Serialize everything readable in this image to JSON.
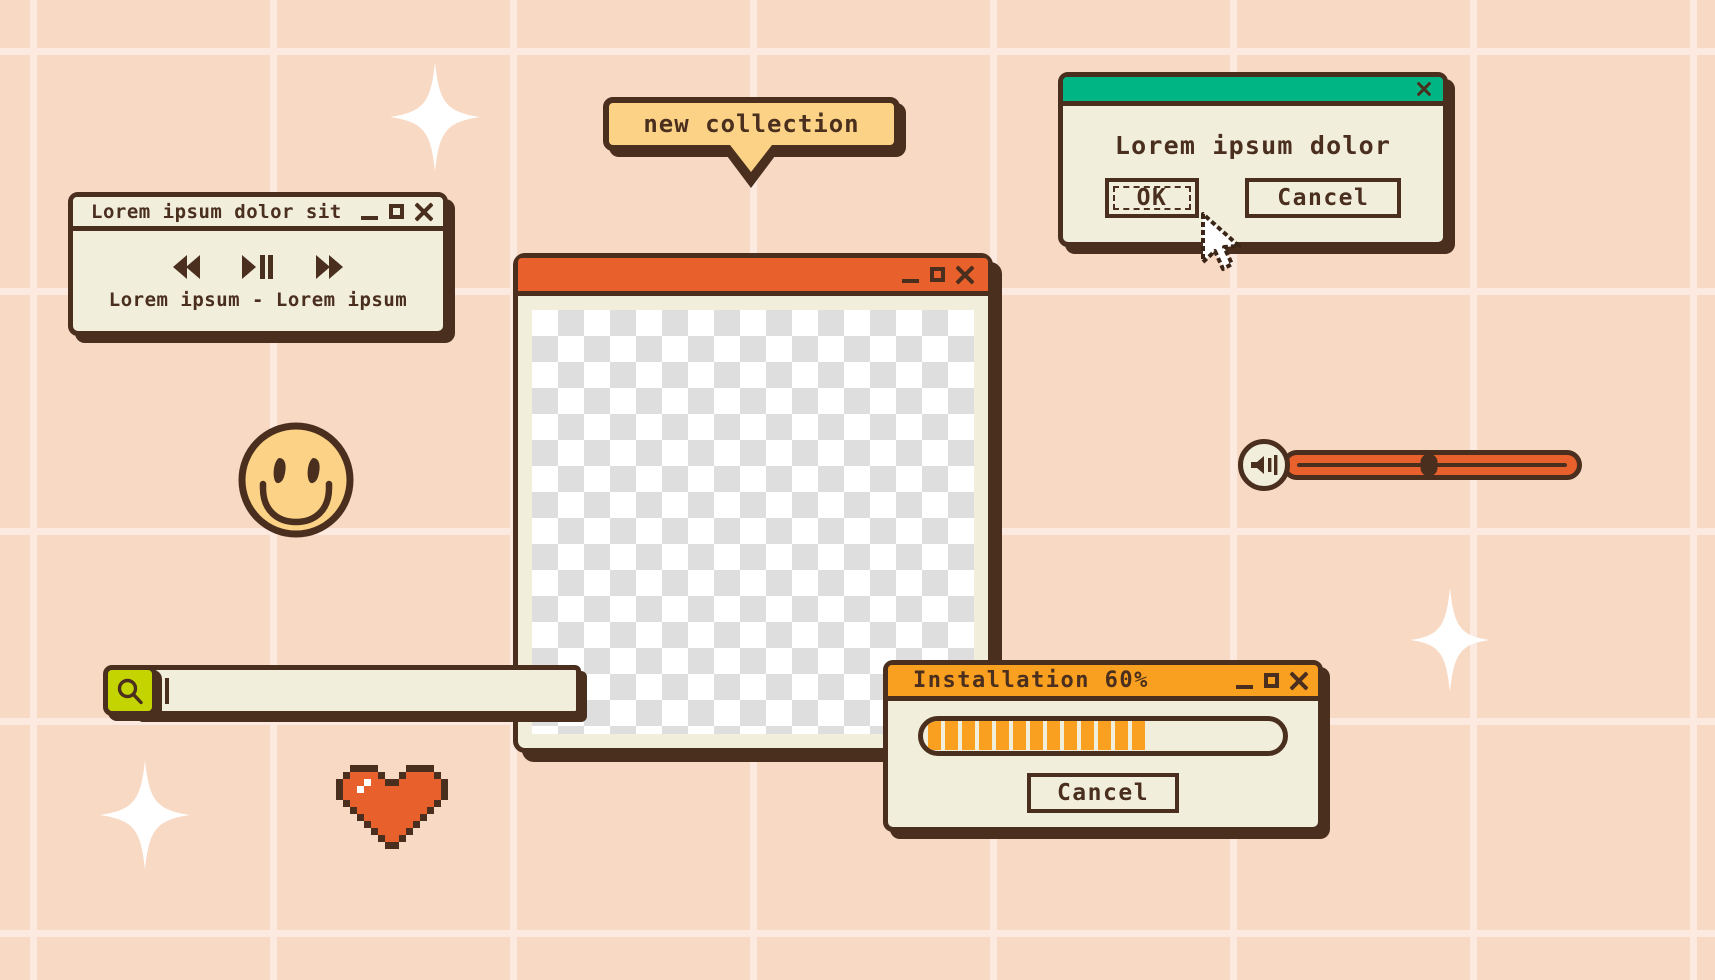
{
  "theme": {
    "background": "#F8D9C4",
    "grid_line": "#FCEAE0",
    "outline": "#4A2E1E",
    "window_fill": "#F2EEDC",
    "accent_orange": "#E8602C",
    "accent_amber": "#F9A020",
    "accent_green": "#00B584",
    "accent_yellow": "#FBD286",
    "accent_lime": "#C4D400"
  },
  "player_window": {
    "title": "Lorem ipsum dolor sit",
    "controls": {
      "minimize": "minimize",
      "maximize": "maximize",
      "close": "close"
    },
    "transport": {
      "previous": "rewind",
      "play_pause": "play-pause",
      "next": "fast-forward"
    },
    "track_label": "Lorem ipsum - Lorem ipsum"
  },
  "speech_bubble": {
    "text": "new collection"
  },
  "dialog_window": {
    "title_bar_color": "#00B584",
    "message": "Lorem ipsum dolor",
    "ok_label": "OK",
    "cancel_label": "Cancel",
    "close_control": "close"
  },
  "cursor": {
    "name": "arrow-pointer"
  },
  "main_window": {
    "title": "",
    "title_bar_color": "#E8602C",
    "content": "transparent-checkerboard-placeholder",
    "controls": {
      "minimize": "minimize",
      "maximize": "maximize",
      "close": "close"
    }
  },
  "install_window": {
    "title": "Installation 60%",
    "progress_percent": 60,
    "progress_segments_filled": 13,
    "progress_segments_total": 22,
    "cancel_label": "Cancel",
    "controls": {
      "minimize": "minimize",
      "maximize": "maximize",
      "close": "close"
    }
  },
  "volume_slider": {
    "icon": "speaker-volume-icon",
    "value_percent": 48
  },
  "search_bar": {
    "icon": "search-icon",
    "value": "",
    "placeholder": ""
  },
  "decorations": {
    "smiley": "smiley-face",
    "pixel_heart": "pixel-heart",
    "sparkles": [
      "sparkle",
      "sparkle",
      "sparkle"
    ]
  }
}
